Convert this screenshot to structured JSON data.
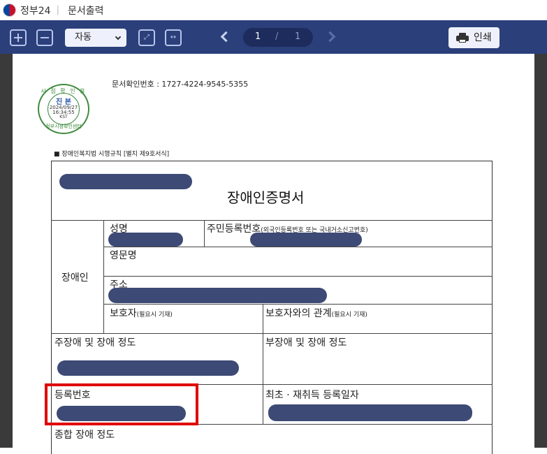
{
  "titlebar": {
    "app_name": "정부24",
    "separator": "|",
    "page_name": "문서출력"
  },
  "toolbar": {
    "zoom_value": "자동",
    "current_page": "1",
    "page_separator": "/",
    "total_pages": "1",
    "print_label": "인쇄",
    "fit_page_glyph": "⤢",
    "fit_width_glyph": "↔"
  },
  "document": {
    "stamp": {
      "top_text": "시 점 확 인 용",
      "center_text": "진 본",
      "date": "2024/09/27",
      "time": "16:34:55",
      "timezone": "KST",
      "bottom_text": "정부시점확인센터"
    },
    "doc_confirm_number": "문서확인번호 : 1727-4224-9545-5355",
    "law_reference": "■ 장애인복지법 시행규칙 [별지 제9호서식]",
    "title": "장애인증명서",
    "fields": {
      "disabled_person": "장애인",
      "name": "성명",
      "resident_number": "주민등록번호",
      "resident_number_note": "(외국인등록번호 또는 국내거소신고번호)",
      "english_name": "영문명",
      "address": "주소",
      "guardian": "보호자",
      "guardian_note": "(필요시 기재)",
      "guardian_relation": "보호자와의 관계",
      "guardian_relation_note": "(필요시 기재)",
      "main_disability": "주장애 및 장애 정도",
      "sub_disability": "부장애 및 장애 정도",
      "registration_number": "등록번호",
      "registration_date": "최초 · 재취득 등록일자",
      "overall_degree": "종합 장애 정도"
    }
  },
  "colors": {
    "toolbar_bg": "#2b3f7a",
    "redaction": "#3d4a75",
    "highlight": "#e00000",
    "stamp": "#3f8a3f"
  }
}
